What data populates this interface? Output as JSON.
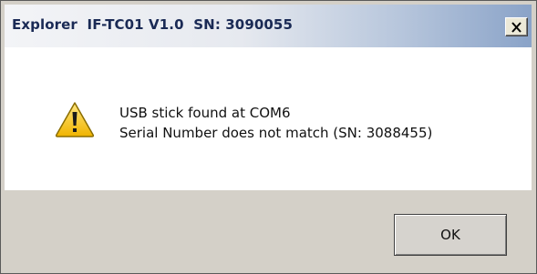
{
  "window": {
    "title": "Explorer  IF-TC01 V1.0  SN: 3090055"
  },
  "dialog": {
    "icon": "warning-icon",
    "message_lines": [
      "USB stick found at COM6",
      "Serial Number does not match (SN: 3088455)"
    ],
    "ok_label": "OK"
  },
  "colors": {
    "title_text": "#1a2a55",
    "warning_fill": "#f5c400",
    "dialog_bg": "#d4d0c8"
  }
}
